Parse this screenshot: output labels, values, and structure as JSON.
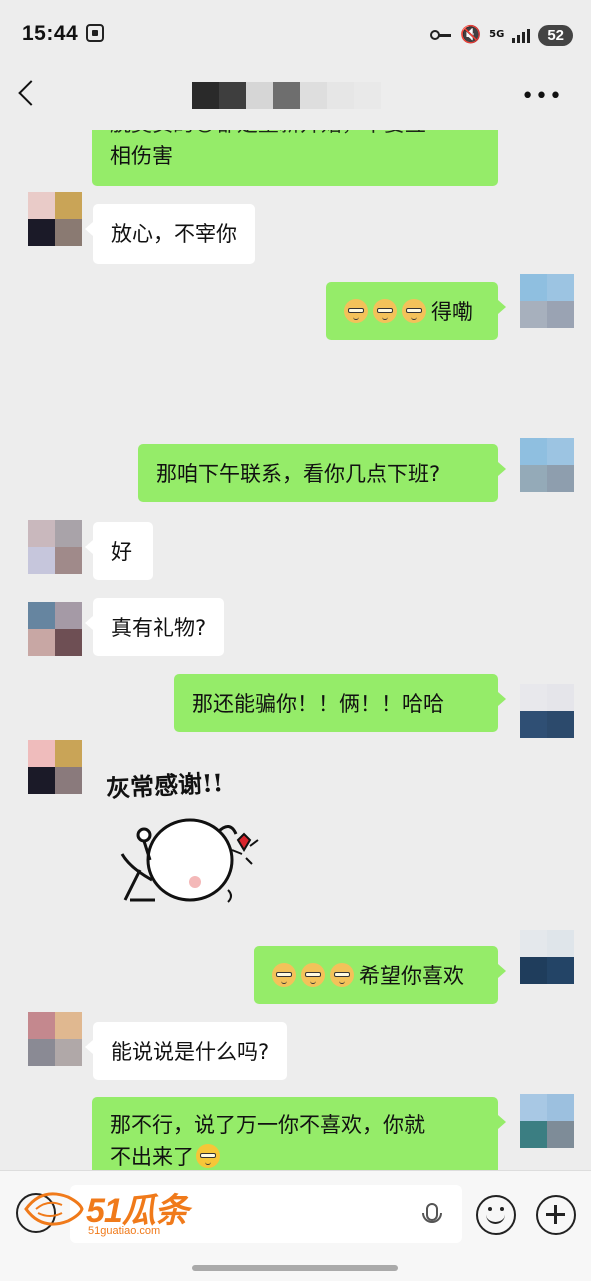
{
  "status_bar": {
    "time": "15:44",
    "network": "5G",
    "battery": "52"
  },
  "header": {
    "title_obscured": true
  },
  "messages": [
    {
      "side": "out",
      "text": "相伤害",
      "partial_top_text": "脱莫货的😊都是重新开始，不要互"
    },
    {
      "side": "in",
      "text": "放心，不宰你"
    },
    {
      "side": "out",
      "emoji_count": 3,
      "text": "得嘞"
    },
    {
      "side": "out",
      "text": "那咱下午联系，看你几点下班?"
    },
    {
      "side": "in",
      "text": "好"
    },
    {
      "side": "in",
      "text": "真有礼物?"
    },
    {
      "side": "out",
      "text": "那还能骗你！！俩！！哈哈"
    },
    {
      "side": "in",
      "sticker_text": "灰常感谢!!"
    },
    {
      "side": "out",
      "emoji_count": 3,
      "text": "希望你喜欢"
    },
    {
      "side": "in",
      "text": "能说说是什么吗?"
    },
    {
      "side": "out",
      "line1": "那不行，说了万一你不喜欢，你就",
      "line2": "不出来了"
    }
  ],
  "input_bar": {
    "watermark_main": "51瓜条",
    "watermark_sub": "51guatiao.com"
  },
  "colors": {
    "background": "#ededed",
    "outgoing_bubble": "#95ec69",
    "incoming_bubble": "#ffffff"
  }
}
